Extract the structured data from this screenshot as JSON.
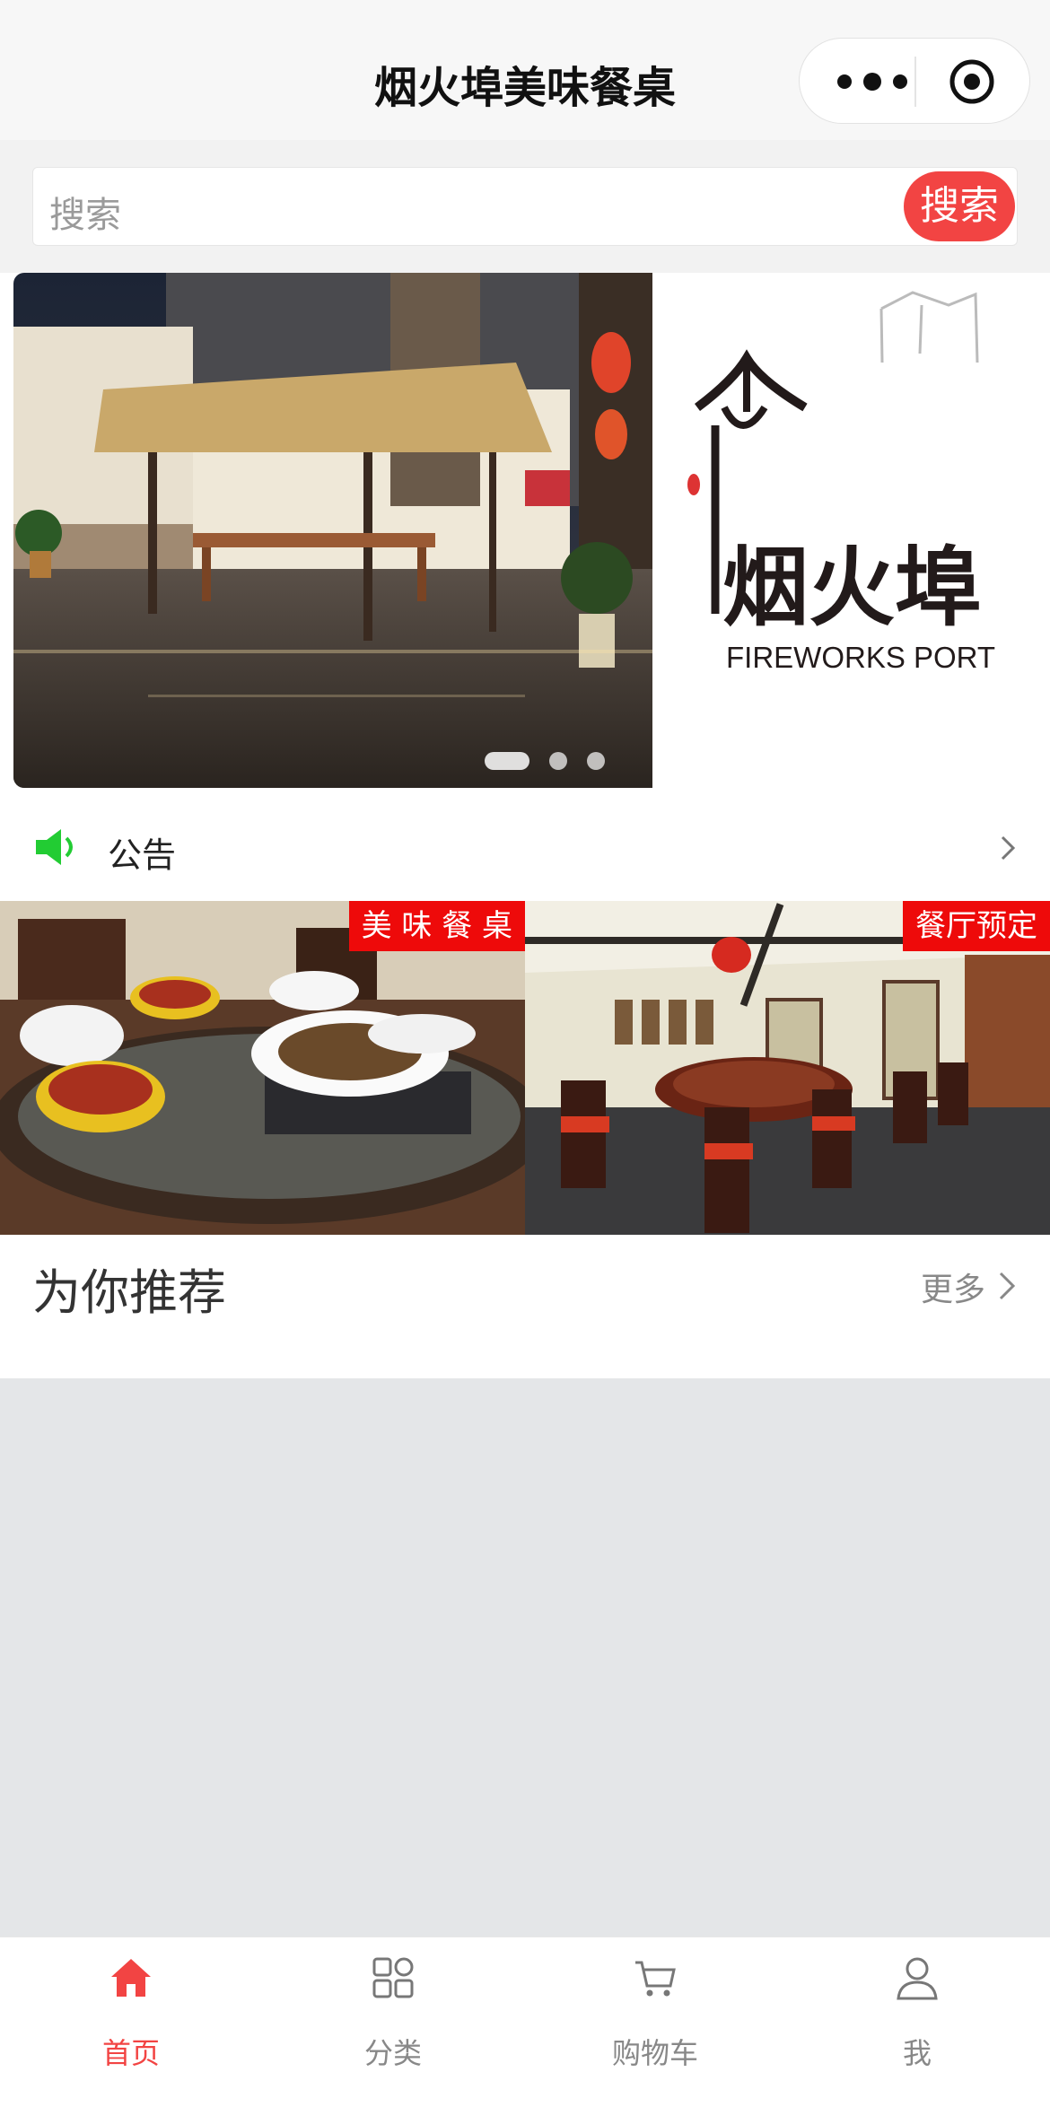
{
  "nav": {
    "title": "烟火埠美味餐桌"
  },
  "search": {
    "placeholder": "搜索",
    "button_label": "搜索"
  },
  "banner": {
    "logo_text_cn": "烟火埠",
    "logo_text_en": "FIREWORKS PORT",
    "slide_count": 3,
    "active_slide": 1
  },
  "notice": {
    "label": "公告"
  },
  "tiles": [
    {
      "tag": "美 味 餐 桌"
    },
    {
      "tag": "餐厅预定"
    }
  ],
  "recommend": {
    "title": "为你推荐",
    "more_label": "更多"
  },
  "tabbar": {
    "items": [
      {
        "label": "首页",
        "icon": "home-icon",
        "active": true
      },
      {
        "label": "分类",
        "icon": "category-icon",
        "active": false
      },
      {
        "label": "购物车",
        "icon": "cart-icon",
        "active": false
      },
      {
        "label": "我",
        "icon": "user-icon",
        "active": false
      }
    ]
  },
  "colors": {
    "accent": "#f24443",
    "tag_red": "#ee0a0a",
    "notice_green": "#22cc33"
  }
}
